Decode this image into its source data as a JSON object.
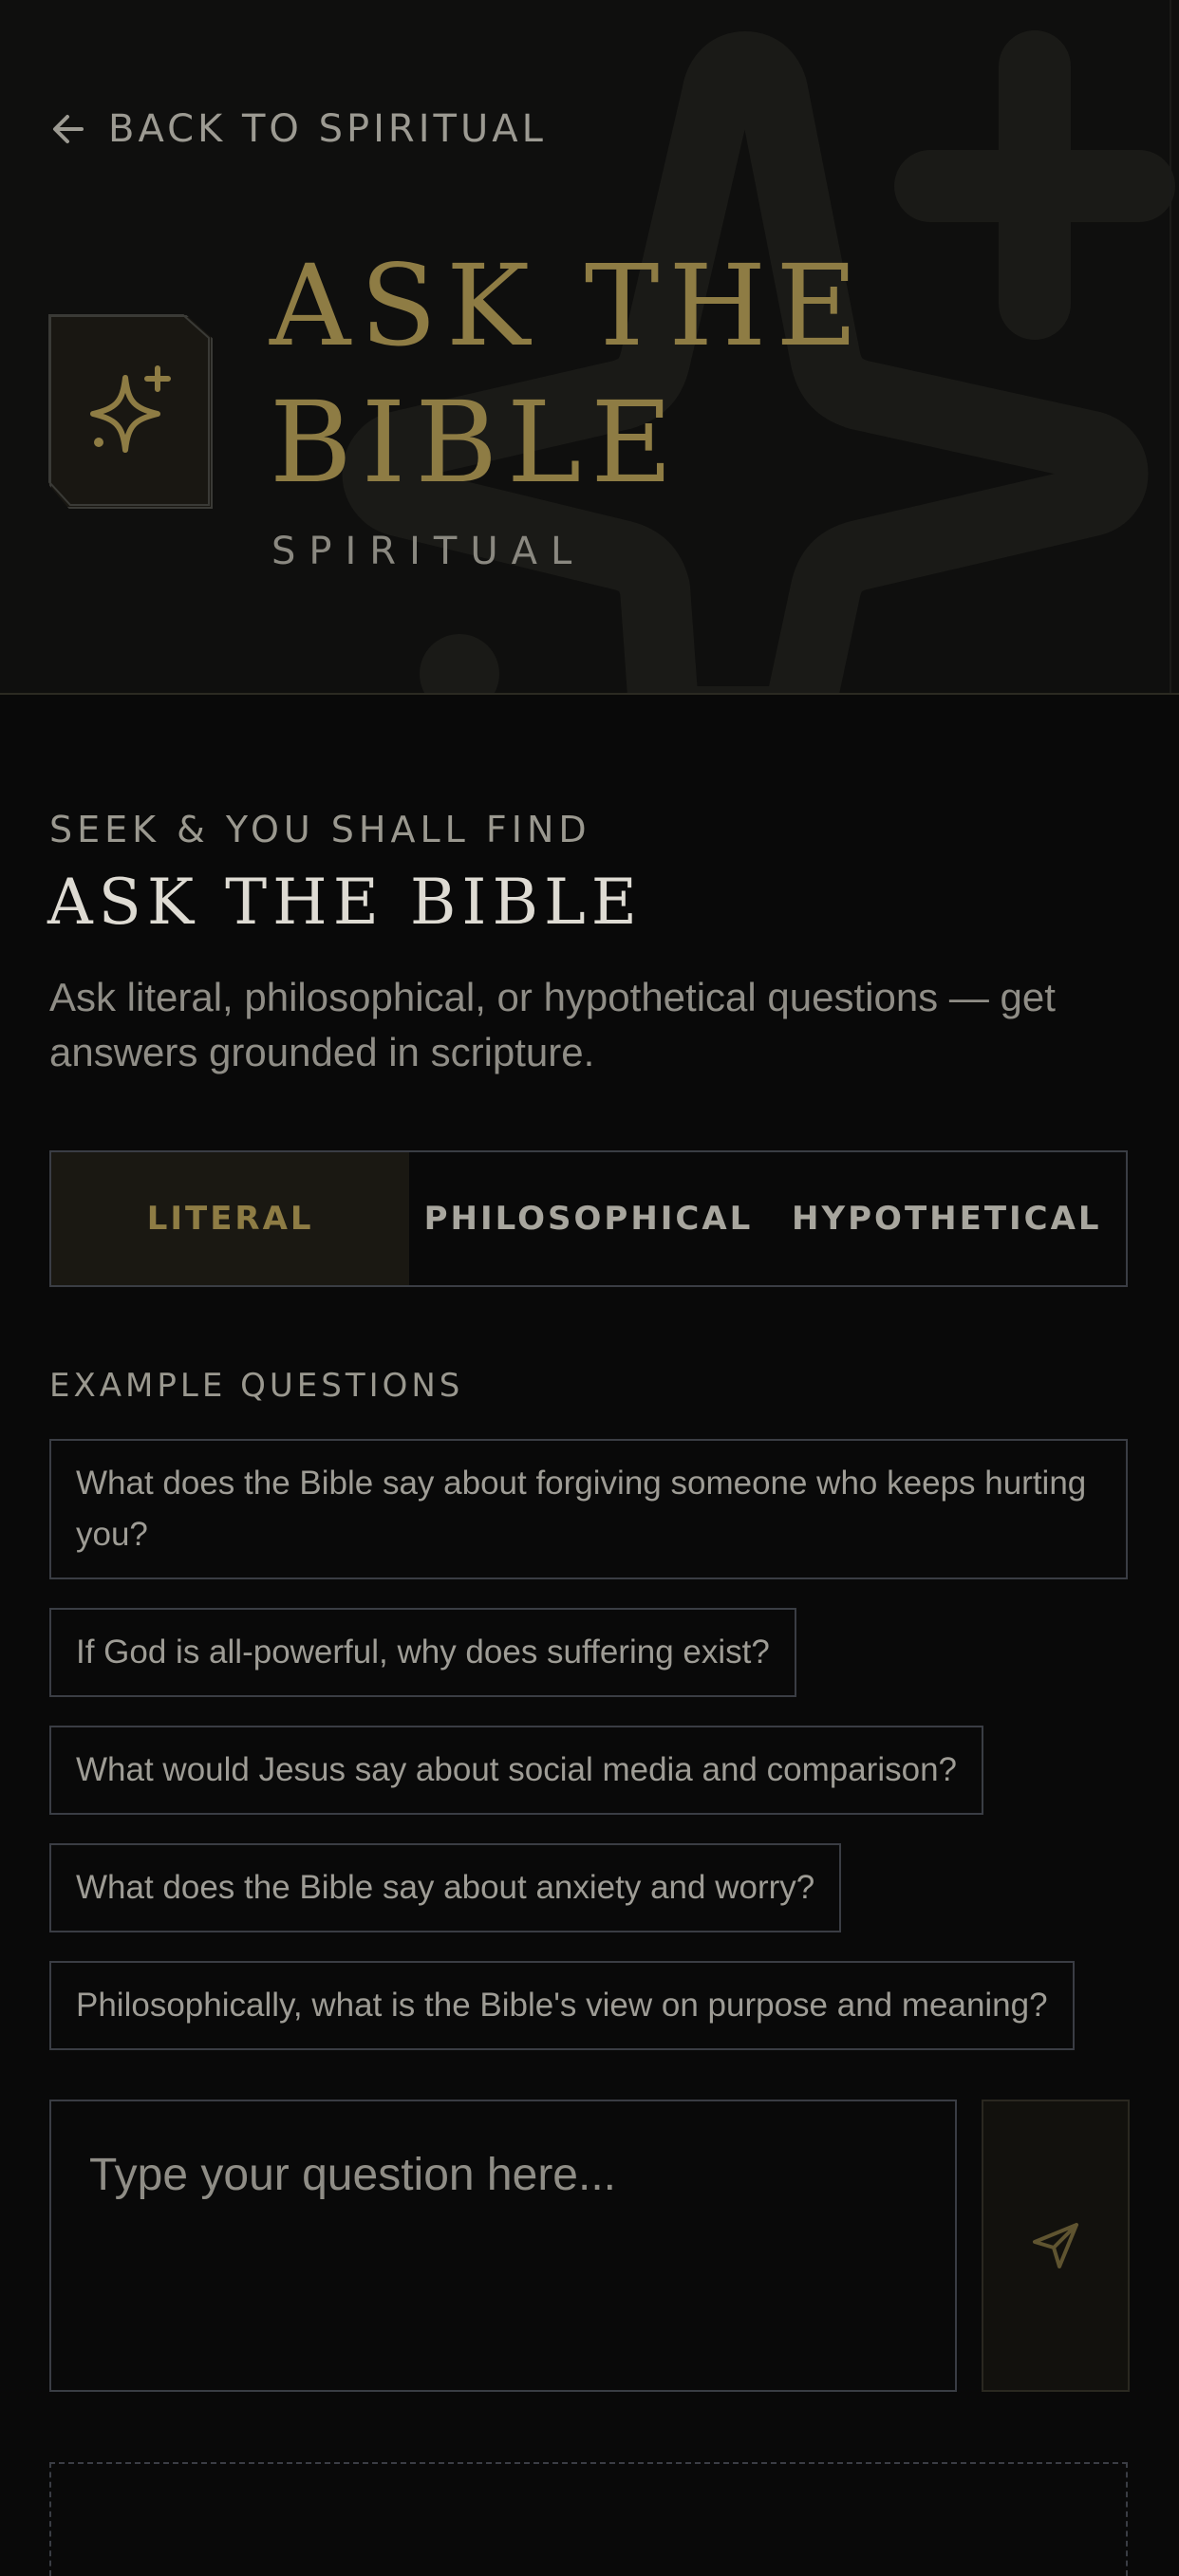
{
  "hero": {
    "back_label": "BACK TO SPIRITUAL",
    "back_icon": "arrow-left-icon",
    "badge_icon": "sparkle-icon",
    "title_line1": "ASK THE",
    "title_line2": "BIBLE",
    "subtitle": "SPIRITUAL"
  },
  "intro": {
    "eyebrow": "SEEK & YOU SHALL FIND",
    "title": "ASK THE BIBLE",
    "description": "Ask literal, philosophical, or hypothetical questions — get answers grounded in scripture."
  },
  "modes": {
    "tabs": [
      {
        "label": "LITERAL",
        "active": true
      },
      {
        "label": "PHILOSOPHICAL",
        "active": false
      },
      {
        "label": "HYPOTHETICAL",
        "active": false
      }
    ]
  },
  "examples": {
    "label": "EXAMPLE QUESTIONS",
    "questions": [
      "What does the Bible say about forgiving someone who keeps hurting you?",
      "If God is all-powerful, why does suffering exist?",
      "What would Jesus say about social media and comparison?",
      "What does the Bible say about anxiety and worry?",
      "Philosophically, what is the Bible's view on purpose and meaning?"
    ]
  },
  "composer": {
    "placeholder": "Type your question here...",
    "value": "",
    "send_icon": "send-icon"
  },
  "colors": {
    "accent_gold": "#8e7c44",
    "background": "#090909",
    "hero_background": "#0f0f0e",
    "border": "#3a3d44",
    "text_muted": "#9a988f"
  }
}
